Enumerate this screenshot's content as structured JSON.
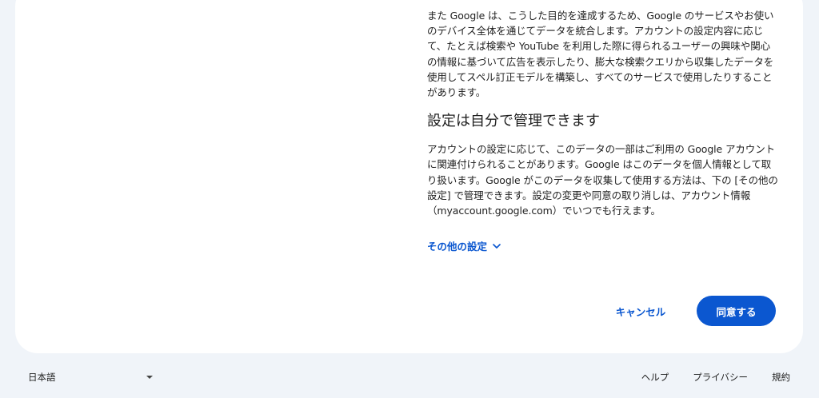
{
  "content": {
    "paragraph1": "また Google は、こうした目的を達成するため、Google のサービスやお使いのデバイス全体を通じてデータを統合します。アカウントの設定内容に応じて、たとえば検索や YouTube を利用した際に得られるユーザーの興味や関心の情報に基づいて広告を表示したり、膨大な検索クエリから収集したデータを使用してスペル訂正モデルを構築し、すべてのサービスで使用したりすることがあります。",
    "heading": "設定は自分で管理できます",
    "paragraph2": "アカウントの設定に応じて、このデータの一部はご利用の Google アカウントに関連付けられることがあります。Google はこのデータを個人情報として取り扱います。Google がこのデータを収集して使用する方法は、下の [その他の設定] で管理できます。設定の変更や同意の取り消しは、アカウント情報（myaccount.google.com）でいつでも行えます。",
    "more_options_label": "その他の設定",
    "more_options_icon": "chevron-down-icon"
  },
  "actions": {
    "cancel_label": "キャンセル",
    "agree_label": "同意する"
  },
  "footer": {
    "language": "日本語",
    "help": "ヘルプ",
    "privacy": "プライバシー",
    "terms": "規約"
  },
  "colors": {
    "accent": "#0b57d0",
    "background": "#f0f4f9",
    "card": "#ffffff"
  }
}
